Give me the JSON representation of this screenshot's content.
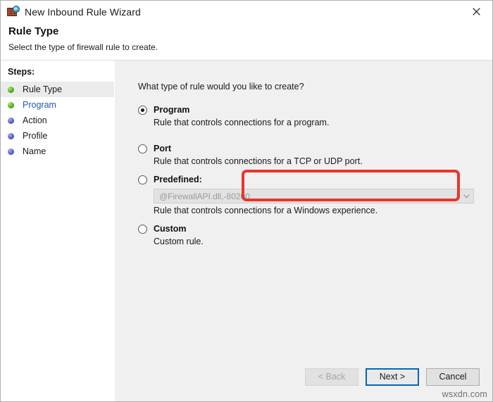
{
  "window": {
    "title": "New Inbound Rule Wizard",
    "icon": "firewall-globe-icon",
    "close_label": "✕"
  },
  "header": {
    "title": "Rule Type",
    "subtitle": "Select the type of firewall rule to create."
  },
  "sidebar": {
    "heading": "Steps:",
    "items": [
      {
        "label": "Rule Type",
        "bullet": "green",
        "state": "current"
      },
      {
        "label": "Program",
        "bullet": "green",
        "state": "link"
      },
      {
        "label": "Action",
        "bullet": "blue",
        "state": "pending"
      },
      {
        "label": "Profile",
        "bullet": "blue",
        "state": "pending"
      },
      {
        "label": "Name",
        "bullet": "blue",
        "state": "pending"
      }
    ]
  },
  "main": {
    "question": "What type of rule would you like to create?",
    "options": [
      {
        "title": "Program",
        "description": "Rule that controls connections for a program.",
        "selected": true,
        "highlighted": true
      },
      {
        "title": "Port",
        "description": "Rule that controls connections for a TCP or UDP port.",
        "selected": false,
        "highlighted": false
      },
      {
        "title": "Predefined:",
        "description": "Rule that controls connections for a Windows experience.",
        "selected": false,
        "highlighted": false,
        "dropdown": {
          "value": "@FirewallAPI.dll,-80200",
          "disabled": true,
          "arrow": "chevron-down-icon"
        }
      },
      {
        "title": "Custom",
        "description": "Custom rule.",
        "selected": false,
        "highlighted": false
      }
    ]
  },
  "footer": {
    "back_label": "< Back",
    "next_label": "Next >",
    "cancel_label": "Cancel"
  },
  "watermark": "wsxdn.com",
  "colors": {
    "highlight_red": "#e8362a",
    "focus_blue": "#0a64b4",
    "link_blue": "#2157b8",
    "panel_gray": "#f0f0f0"
  }
}
